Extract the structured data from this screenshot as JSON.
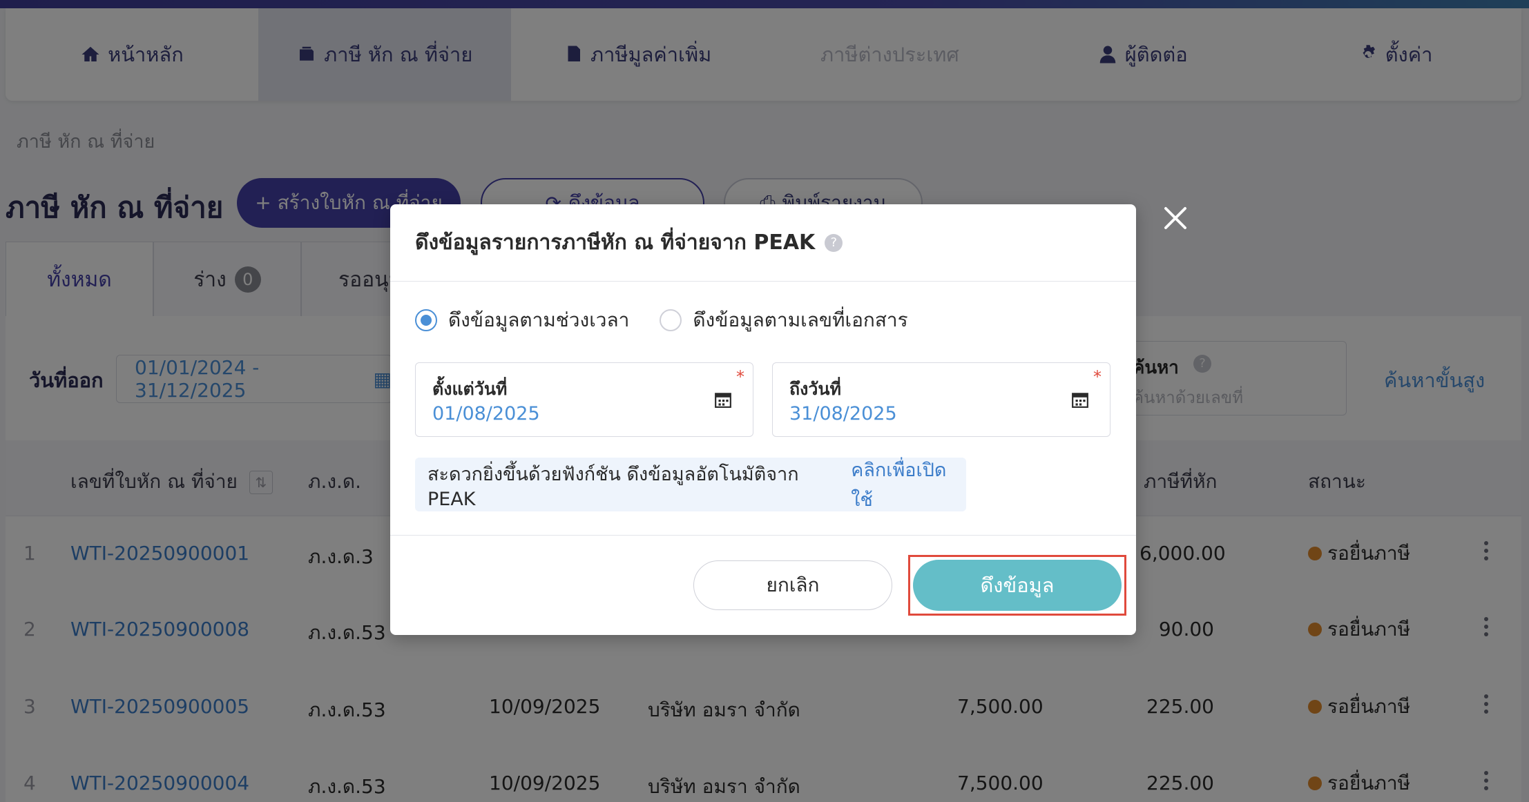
{
  "nav": {
    "items": [
      {
        "label": "หน้าหลัก",
        "icon": "home-icon"
      },
      {
        "label": "ภาษี หัก ณ ที่จ่าย",
        "icon": "wallet-icon"
      },
      {
        "label": "ภาษีมูลค่าเพิ่ม",
        "icon": "document-icon"
      },
      {
        "label": "ภาษีต่างประเทศ",
        "icon": ""
      },
      {
        "label": "ผู้ติดต่อ",
        "icon": "user-icon"
      },
      {
        "label": "ตั้งค่า",
        "icon": "gear-icon"
      }
    ]
  },
  "breadcrumb": "ภาษี หัก ณ ที่จ่าย",
  "page": {
    "title": "ภาษี หัก ณ ที่จ่าย",
    "create_button": "+ สร้างใบหัก ณ ที่จ่าย",
    "fetch_button": "ดึงข้อมูล",
    "print_button": "พิมพ์รายงาน"
  },
  "tabs": [
    {
      "label": "ทั้งหมด"
    },
    {
      "label": "ร่าง",
      "count": "0"
    },
    {
      "label": "รออนุมัติ"
    }
  ],
  "filters": {
    "issue_date_label": "วันที่ออก",
    "date_range": "01/01/2024 - 31/12/2025",
    "search_label": "ค้นหา",
    "search_placeholder": "ค้นหาด้วยเลขที่",
    "advanced_search": "ค้นหาขั้นสูง"
  },
  "table": {
    "headers": {
      "doc_no": "เลขที่ใบหัก ณ ที่จ่าย",
      "form": "ภ.ง.ด.",
      "tax": "ภาษีที่หัก",
      "status": "สถานะ"
    },
    "rows": [
      {
        "num": "1",
        "doc": "WTI-20250900001",
        "form": "ภ.ง.ด.3",
        "date": "",
        "contact": "",
        "amount": "",
        "tax": "6,000.00",
        "status": "รอยื่นภาษี"
      },
      {
        "num": "2",
        "doc": "WTI-20250900008",
        "form": "ภ.ง.ด.53",
        "date": "",
        "contact": "",
        "amount": "",
        "tax": "90.00",
        "status": "รอยื่นภาษี"
      },
      {
        "num": "3",
        "doc": "WTI-20250900005",
        "form": "ภ.ง.ด.53",
        "date": "10/09/2025",
        "contact": "บริษัท อมรา จำกัด",
        "amount": "7,500.00",
        "tax": "225.00",
        "status": "รอยื่นภาษี"
      },
      {
        "num": "4",
        "doc": "WTI-20250900004",
        "form": "ภ.ง.ด.53",
        "date": "10/09/2025",
        "contact": "บริษัท อมรา จำกัด",
        "amount": "7,500.00",
        "tax": "225.00",
        "status": "รอยื่นภาษี"
      }
    ]
  },
  "modal": {
    "title": "ดึงข้อมูลรายการภาษีหัก ณ ที่จ่ายจาก PEAK",
    "radio_by_period": "ดึงข้อมูลตามช่วงเวลา",
    "radio_by_doc": "ดึงข้อมูลตามเลขที่เอกสาร",
    "from_label": "ตั้งแต่วันที่",
    "from_value": "01/08/2025",
    "to_label": "ถึงวันที่",
    "to_value": "31/08/2025",
    "info_text": "สะดวกยิ่งขึ้นด้วยฟังก์ชัน ดึงข้อมูลอัตโนมัติจาก PEAK",
    "info_link": "คลิกเพื่อเปิดใช้",
    "cancel": "ยกเลิก",
    "confirm": "ดึงข้อมูล",
    "required_mark": "*",
    "help_mark": "?"
  },
  "colors": {
    "primary": "#4540a8",
    "link": "#3b7cc9",
    "confirm": "#64bec8",
    "highlight": "#e04a3c",
    "status_pending": "#e08a2c"
  }
}
